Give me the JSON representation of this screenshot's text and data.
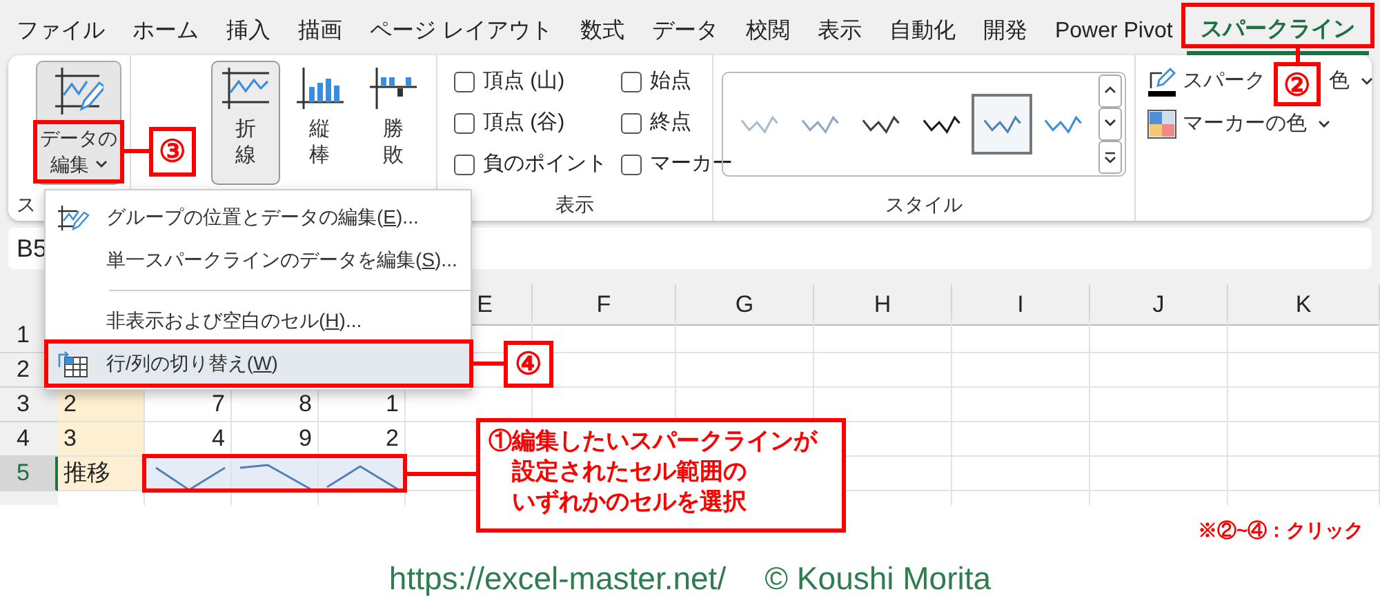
{
  "tabs": [
    {
      "label": "ファイル",
      "selected": false
    },
    {
      "label": "ホーム",
      "selected": false
    },
    {
      "label": "挿入",
      "selected": false
    },
    {
      "label": "描画",
      "selected": false
    },
    {
      "label": "ページ レイアウト",
      "selected": false
    },
    {
      "label": "数式",
      "selected": false
    },
    {
      "label": "データ",
      "selected": false
    },
    {
      "label": "校閲",
      "selected": false
    },
    {
      "label": "表示",
      "selected": false
    },
    {
      "label": "自動化",
      "selected": false
    },
    {
      "label": "開発",
      "selected": false
    },
    {
      "label": "Power Pivot",
      "selected": false
    },
    {
      "label": "スパークライン",
      "selected": true
    }
  ],
  "ribbon": {
    "edit_data": {
      "lines": [
        "データの",
        "編集"
      ]
    },
    "group_label": "ス",
    "chart_types": [
      {
        "kind": "line",
        "label": "折線",
        "selected": true
      },
      {
        "kind": "column",
        "label": "縦棒",
        "selected": false
      },
      {
        "kind": "winloss",
        "label": "勝敗",
        "selected": false
      }
    ],
    "show_options": [
      {
        "label": "頂点 (山)",
        "checked": false
      },
      {
        "label": "頂点 (谷)",
        "checked": false
      },
      {
        "label": "負のポイント",
        "checked": false
      },
      {
        "label": "始点",
        "checked": false
      },
      {
        "label": "終点",
        "checked": false
      },
      {
        "label": "マーカー",
        "checked": false
      }
    ],
    "show_label": "表示",
    "styles": [
      {
        "color": "#a9bccf",
        "selected": false
      },
      {
        "color": "#8ea6c0",
        "selected": false
      },
      {
        "color": "#404040",
        "selected": false
      },
      {
        "color": "#1a1a1a",
        "selected": false
      },
      {
        "color": "#4f7fb8",
        "selected": true
      },
      {
        "color": "#3a8ee0",
        "selected": false
      }
    ],
    "style_label": "スタイル",
    "sparkline_color": {
      "visible_start": "スパーク",
      "visible_end": "色"
    },
    "marker_color": {
      "label": "マーカーの色"
    }
  },
  "name_box": "B5",
  "columns": [
    "E",
    "F",
    "G",
    "H",
    "I",
    "J",
    "K"
  ],
  "rows": [
    {
      "number": "1",
      "kind": "numbers",
      "selected": false,
      "cells": []
    },
    {
      "number": "2",
      "kind": "numbers",
      "selected": false,
      "cells": []
    },
    {
      "number": "3",
      "kind": "numbers",
      "selected": false,
      "cells": [
        "2",
        "7",
        "8",
        "1"
      ]
    },
    {
      "number": "4",
      "kind": "numbers",
      "selected": false,
      "cells": [
        "3",
        "4",
        "9",
        "2"
      ]
    },
    {
      "number": "5",
      "kind": "sparklines",
      "selected": true,
      "cells": [
        "推移"
      ]
    }
  ],
  "menu": [
    {
      "kind": "group",
      "text": "グループの位置とデータの編集(",
      "key": "E",
      "after": ")...",
      "highlighted": false
    },
    {
      "kind": "plain",
      "text": "単一スパークラインのデータを編集(",
      "key": "S",
      "after": ")...",
      "highlighted": false
    },
    {
      "kind": "separator"
    },
    {
      "kind": "plain",
      "text": "非表示および空白のセル(",
      "key": "H",
      "after": ")...",
      "highlighted": false
    },
    {
      "kind": "switch",
      "text": "行/列の切り替え(",
      "key": "W",
      "after": ")",
      "highlighted": true
    }
  ],
  "annotations": {
    "step1": [
      "①編集したいスパークラインが",
      "設定されたセル範囲の",
      "いずれかのセルを選択"
    ],
    "step2": "②",
    "step3": "③",
    "step4": "④",
    "note": "※②~④：クリック"
  },
  "footer": {
    "url": "https://excel-master.net/",
    "copyright": "© Koushi Morita"
  }
}
